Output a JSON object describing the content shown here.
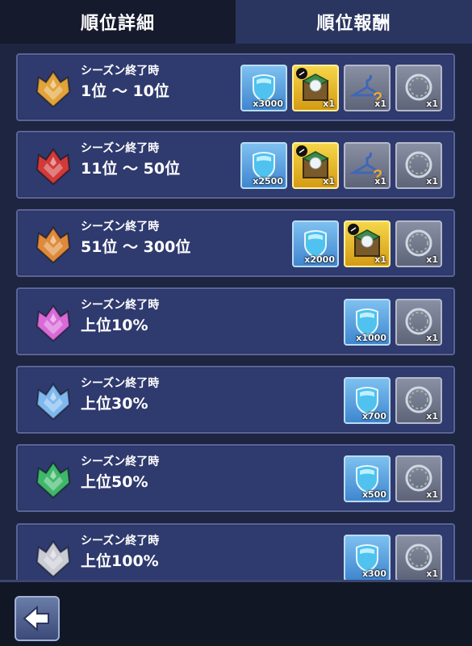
{
  "tabs": {
    "detail": "順位詳細",
    "reward": "順位報酬"
  },
  "rows": [
    {
      "line1": "シーズン終了時",
      "line2": "1位 ～ 10位",
      "badge": "gold-crest-icon",
      "badge_color": "#e1a33a",
      "items": [
        {
          "kind": "blue",
          "icon": "shield-gem-icon",
          "qty": "x3000"
        },
        {
          "kind": "gold",
          "icon": "treasure-box-icon",
          "qty": "x1"
        },
        {
          "kind": "gray",
          "icon": "hanger-icon",
          "qty": "x1"
        },
        {
          "kind": "gray",
          "icon": "wreath-frame-icon",
          "qty": "x1"
        }
      ]
    },
    {
      "line1": "シーズン終了時",
      "line2": "11位 ～ 50位",
      "badge": "red-crest-icon",
      "badge_color": "#d23a3a",
      "items": [
        {
          "kind": "blue",
          "icon": "shield-gem-icon",
          "qty": "x2500"
        },
        {
          "kind": "gold",
          "icon": "treasure-box-icon",
          "qty": "x1"
        },
        {
          "kind": "gray",
          "icon": "hanger-icon",
          "qty": "x1"
        },
        {
          "kind": "gray",
          "icon": "wreath-frame-icon",
          "qty": "x1"
        }
      ]
    },
    {
      "line1": "シーズン終了時",
      "line2": "51位 ～ 300位",
      "badge": "orange-crest-icon",
      "badge_color": "#df8a3a",
      "items": [
        {
          "kind": "blue",
          "icon": "shield-gem-icon",
          "qty": "x2000"
        },
        {
          "kind": "gold",
          "icon": "treasure-box-icon",
          "qty": "x1"
        },
        {
          "kind": "gray",
          "icon": "wreath-frame-icon",
          "qty": "x1"
        }
      ]
    },
    {
      "line1": "シーズン終了時",
      "line2": "上位10%",
      "badge": "pink-crest-icon",
      "badge_color": "#d86ad8",
      "items": [
        {
          "kind": "blue",
          "icon": "shield-gem-icon",
          "qty": "x1000"
        },
        {
          "kind": "gray",
          "icon": "wreath-frame-icon",
          "qty": "x1"
        }
      ]
    },
    {
      "line1": "シーズン終了時",
      "line2": "上位30%",
      "badge": "lightblue-crest-icon",
      "badge_color": "#7fb8ee",
      "items": [
        {
          "kind": "blue",
          "icon": "shield-gem-icon",
          "qty": "x700"
        },
        {
          "kind": "gray",
          "icon": "wreath-frame-icon",
          "qty": "x1"
        }
      ]
    },
    {
      "line1": "シーズン終了時",
      "line2": "上位50%",
      "badge": "green-crest-icon",
      "badge_color": "#3fb86a",
      "items": [
        {
          "kind": "blue",
          "icon": "shield-gem-icon",
          "qty": "x500"
        },
        {
          "kind": "gray",
          "icon": "wreath-frame-icon",
          "qty": "x1"
        }
      ]
    },
    {
      "line1": "シーズン終了時",
      "line2": "上位100%",
      "badge": "silver-crest-icon",
      "badge_color": "#c9ccd4",
      "items": [
        {
          "kind": "blue",
          "icon": "shield-gem-icon",
          "qty": "x300"
        },
        {
          "kind": "gray",
          "icon": "wreath-frame-icon",
          "qty": "x1"
        }
      ]
    }
  ],
  "footer": {
    "back_icon": "back-arrow-icon"
  }
}
